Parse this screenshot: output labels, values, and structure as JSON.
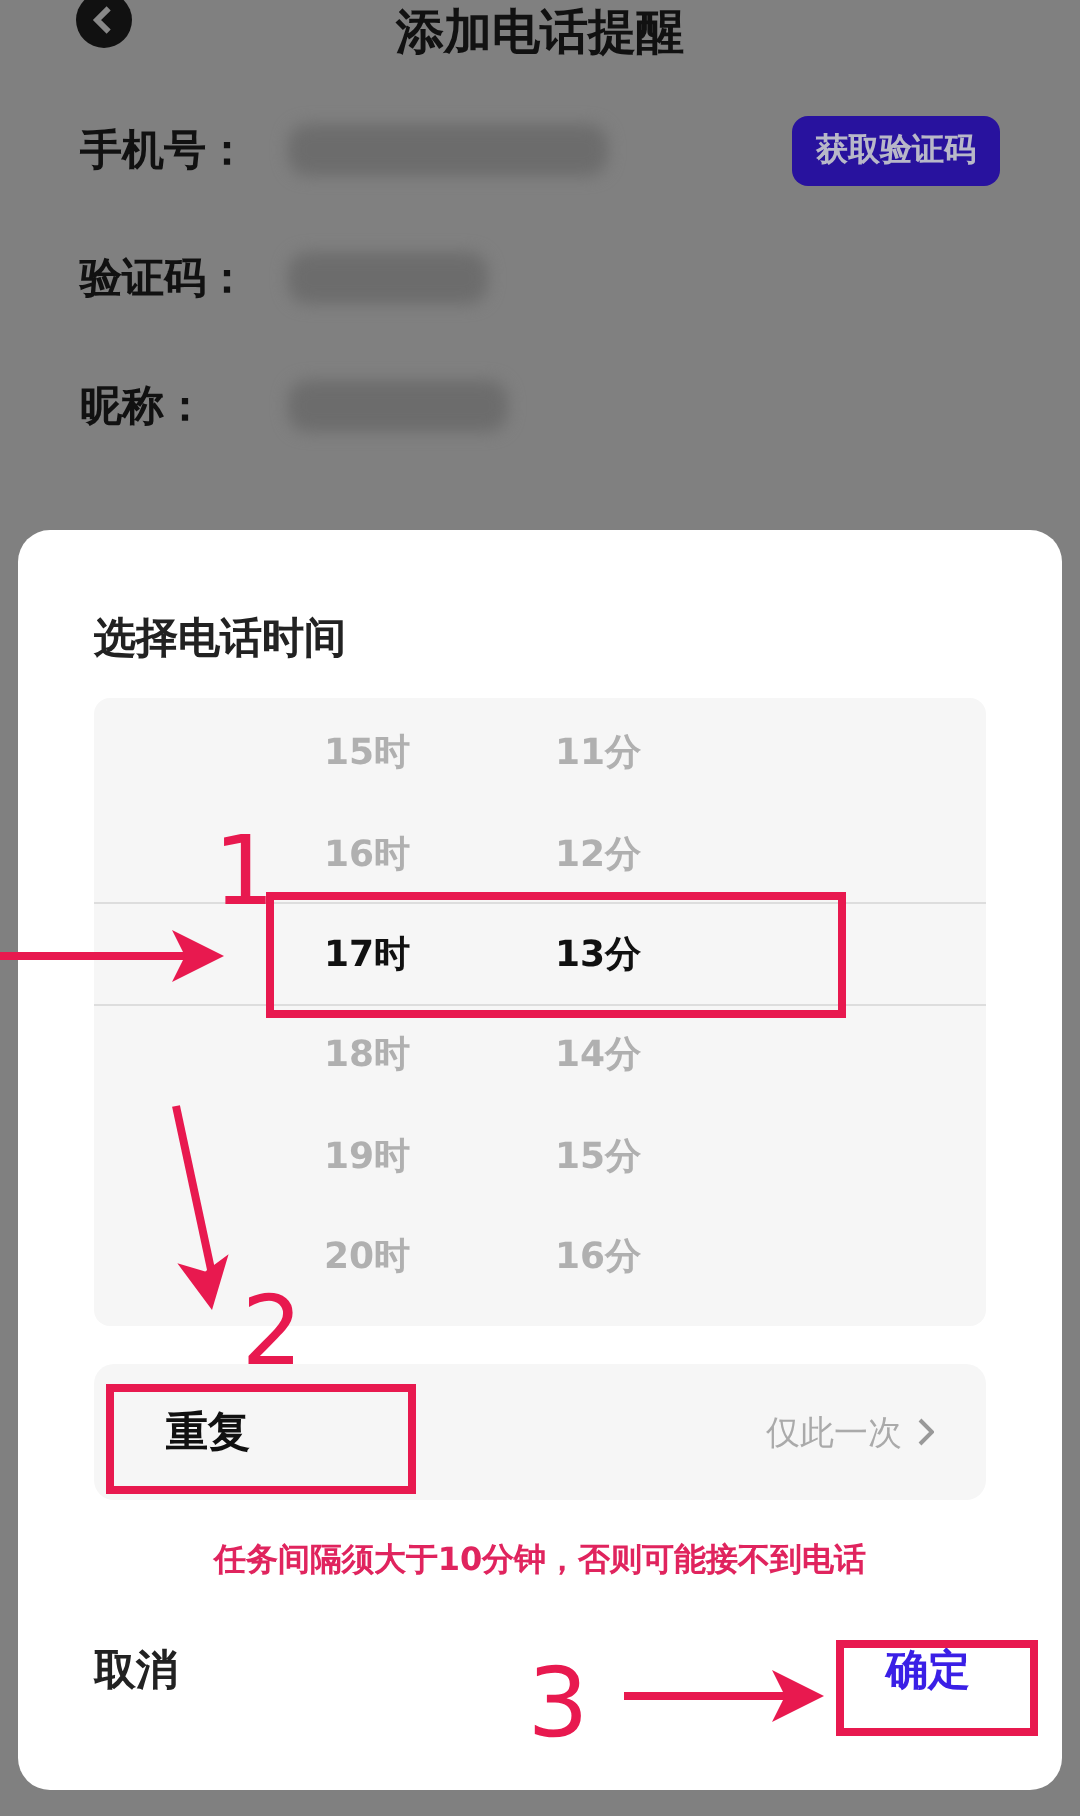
{
  "header": {
    "title": "添加电话提醒"
  },
  "form": {
    "fields": [
      {
        "label": "手机号："
      },
      {
        "label": "验证码："
      },
      {
        "label": "昵称："
      }
    ],
    "get_code_button": "获取验证码"
  },
  "sheet": {
    "title": "选择电话时间",
    "hours": [
      {
        "label": "15时",
        "selected": false
      },
      {
        "label": "16时",
        "selected": false
      },
      {
        "label": "17时",
        "selected": true
      },
      {
        "label": "18时",
        "selected": false
      },
      {
        "label": "19时",
        "selected": false
      },
      {
        "label": "20时",
        "selected": false
      }
    ],
    "minutes": [
      {
        "label": "11分",
        "selected": false
      },
      {
        "label": "12分",
        "selected": false
      },
      {
        "label": "13分",
        "selected": true
      },
      {
        "label": "14分",
        "selected": false
      },
      {
        "label": "15分",
        "selected": false
      },
      {
        "label": "16分",
        "selected": false
      }
    ],
    "repeat": {
      "label": "重复",
      "value": "仅此一次"
    },
    "warning": "任务间隔须大于10分钟，否则可能接不到电话",
    "cancel": "取消",
    "confirm": "确定"
  },
  "annotations": [
    {
      "number": "1"
    },
    {
      "number": "2"
    },
    {
      "number": "3"
    }
  ]
}
